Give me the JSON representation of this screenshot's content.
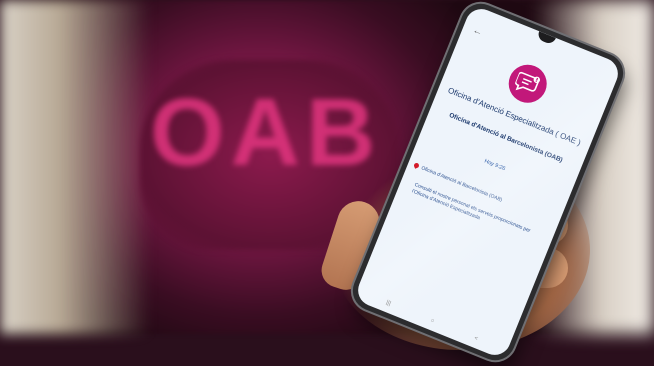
{
  "background": {
    "logo_text": "OAB",
    "accent_color": "#e2357f"
  },
  "phone": {
    "app": {
      "icon": "chat-bubble-info-icon",
      "brand_color": "#c2187a",
      "title": "Oficina d'Atenció Especialitzada ( OAE )",
      "subtitle": "Oficina d'Atenció al Barcelonista (OAB)",
      "time": "Hoy 9:26",
      "location": "Oficina d'Atenció al Barcelonista (OAB)",
      "description": "Consulti el nostre personal els serveis proporcionats per l'Oficina d'Atenció Especialitzada",
      "nav": {
        "menu": "|||",
        "home": "○",
        "back": "<"
      }
    }
  }
}
